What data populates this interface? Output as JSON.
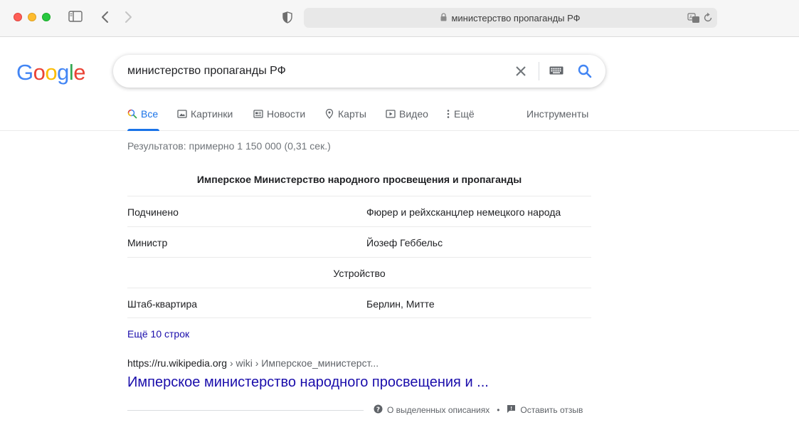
{
  "browser": {
    "url_text": "министерство пропаганды РФ"
  },
  "logo": {
    "letters": [
      "G",
      "o",
      "o",
      "g",
      "l",
      "e"
    ],
    "colors": [
      "#4285f4",
      "#ea4335",
      "#fbbc05",
      "#4285f4",
      "#34a853",
      "#ea4335"
    ]
  },
  "search": {
    "query": "министерство пропаганды РФ"
  },
  "tabs": [
    {
      "label": "Все",
      "icon": "search-icon",
      "active": true
    },
    {
      "label": "Картинки",
      "icon": "image-icon"
    },
    {
      "label": "Новости",
      "icon": "news-icon"
    },
    {
      "label": "Карты",
      "icon": "map-pin-icon"
    },
    {
      "label": "Видео",
      "icon": "video-icon"
    },
    {
      "label": "Ещё",
      "icon": "more-vert-icon"
    },
    {
      "label": "Инструменты"
    }
  ],
  "stats": "Результатов: примерно 1 150 000 (0,31 сек.)",
  "table": {
    "title": "Имперское Министерство народного просвещения и пропаганды",
    "rows": [
      {
        "key": "Подчинено",
        "value": "Фюрер и рейхсканцлер немецкого народа"
      },
      {
        "key": "Министр",
        "value": "Йозеф Геббельс"
      },
      {
        "center": "Устройство"
      },
      {
        "key": "Штаб-квартира",
        "value": "Берлин, Митте"
      }
    ],
    "more_link": "Ещё 10 строк"
  },
  "result": {
    "domain": "https://ru.wikipedia.org",
    "path": " › wiki › Имперское_министерст...",
    "title": "Имперское министерство народного просвещения и ..."
  },
  "footer": {
    "about": "О выделенных описаниях",
    "feedback": "Оставить отзыв"
  },
  "colors": {
    "link": "#1a0dab",
    "accent": "#1a73e8"
  }
}
